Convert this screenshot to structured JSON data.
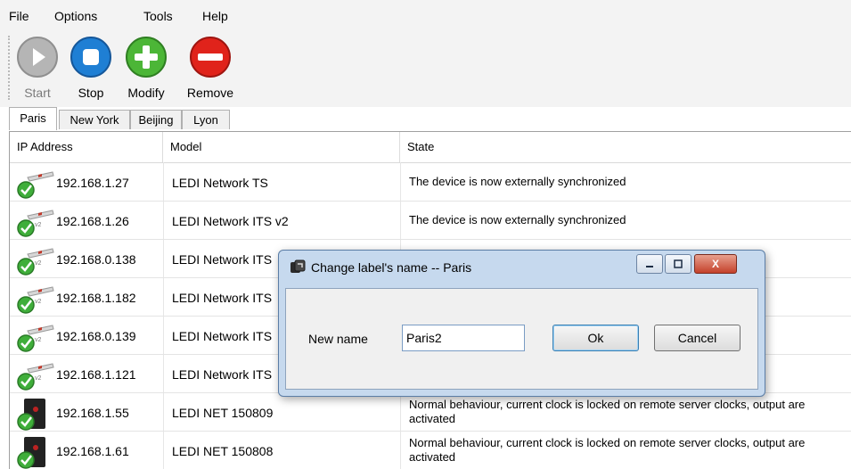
{
  "menu": [
    "File",
    "Options",
    "Tools",
    "Help"
  ],
  "toolbar": {
    "start_label": "Start",
    "stop_label": "Stop",
    "modify_label": "Modify",
    "remove_label": "Remove",
    "colors": {
      "start": "#b5b5b5",
      "stop": "#1f7fd4",
      "modify": "#4cb637",
      "remove": "#e0231b"
    }
  },
  "tabs": [
    "Paris",
    "New York",
    "Beijing",
    "Lyon"
  ],
  "table": {
    "headers": [
      "IP Address",
      "Model",
      "State"
    ],
    "rows": [
      {
        "ip": "192.168.1.27",
        "model": "LEDI Network TS",
        "state": "The device is now externally synchronized",
        "icon": "network-device-ok-icon"
      },
      {
        "ip": "192.168.1.26",
        "model": "LEDI Network ITS v2",
        "state": "The device is now externally synchronized",
        "icon": "network-device-v2-ok-icon"
      },
      {
        "ip": "192.168.0.138",
        "model": "LEDI Network ITS",
        "state": "",
        "icon": "network-device-v2-ok-icon"
      },
      {
        "ip": "192.168.1.182",
        "model": "LEDI Network ITS",
        "state": "",
        "icon": "network-device-v2-ok-icon"
      },
      {
        "ip": "192.168.0.139",
        "model": "LEDI Network ITS",
        "state": "",
        "icon": "network-device-v2-ok-icon"
      },
      {
        "ip": "192.168.1.121",
        "model": "LEDI Network ITS",
        "state": "",
        "icon": "network-device-v2-ok-icon"
      },
      {
        "ip": "192.168.1.55",
        "model": "LEDI NET 150809",
        "state": "Normal behaviour, current clock is locked on remote server clocks, output are activated",
        "icon": "clock-device-ok-icon"
      },
      {
        "ip": "192.168.1.61",
        "model": "LEDI NET 150808",
        "state": "Normal behaviour, current clock is locked on remote server clocks, output are activated",
        "icon": "clock-device-ok-icon"
      }
    ]
  },
  "dialog": {
    "title": "Change label's name -- Paris",
    "field_label": "New name",
    "field_value": "Paris2",
    "ok_label": "Ok",
    "cancel_label": "Cancel",
    "close_label": "X"
  }
}
